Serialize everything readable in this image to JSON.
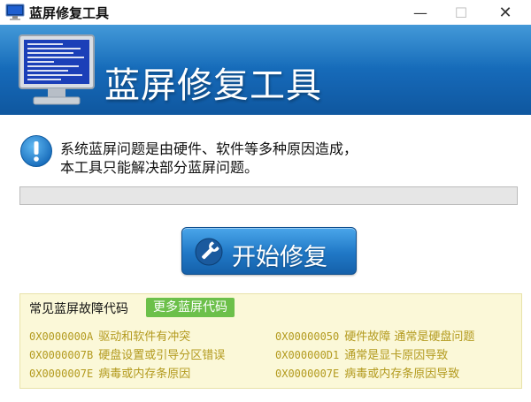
{
  "window": {
    "title": "蓝屏修复工具",
    "minimize_glyph": "—",
    "maximize_glyph": "☐",
    "close_glyph": "✕"
  },
  "header": {
    "title": "蓝屏修复工具",
    "icon": "bsod-monitor-icon"
  },
  "info": {
    "icon": "info-icon",
    "line1": "系统蓝屏问题是由硬件、软件等多种原因造成，",
    "line2": "本工具只能解决部分蓝屏问题。"
  },
  "progress": {
    "value_percent": 0
  },
  "actions": {
    "start_label": "开始修复",
    "start_icon": "wrench-icon"
  },
  "codes_panel": {
    "title": "常见蓝屏故障代码",
    "more_label": "更多蓝屏代码",
    "rows": [
      {
        "code": "0X0000000A",
        "desc": "驱动和软件有冲突"
      },
      {
        "code": "0X00000050",
        "desc": "硬件故障 通常是硬盘问题"
      },
      {
        "code": "0X0000007B",
        "desc": "硬盘设置或引导分区错误"
      },
      {
        "code": "0X000000D1",
        "desc": "通常是显卡原因导致"
      },
      {
        "code": "0X0000007E",
        "desc": "病毒或内存条原因"
      },
      {
        "code": "0X0000007E",
        "desc": "病毒或内存条原因导致"
      }
    ]
  },
  "colors": {
    "banner": "#1566b4",
    "button": "#2078c6",
    "code_text": "#b39a1e",
    "panel_bg": "#fbf8d8",
    "more_button": "#6cc04a"
  }
}
